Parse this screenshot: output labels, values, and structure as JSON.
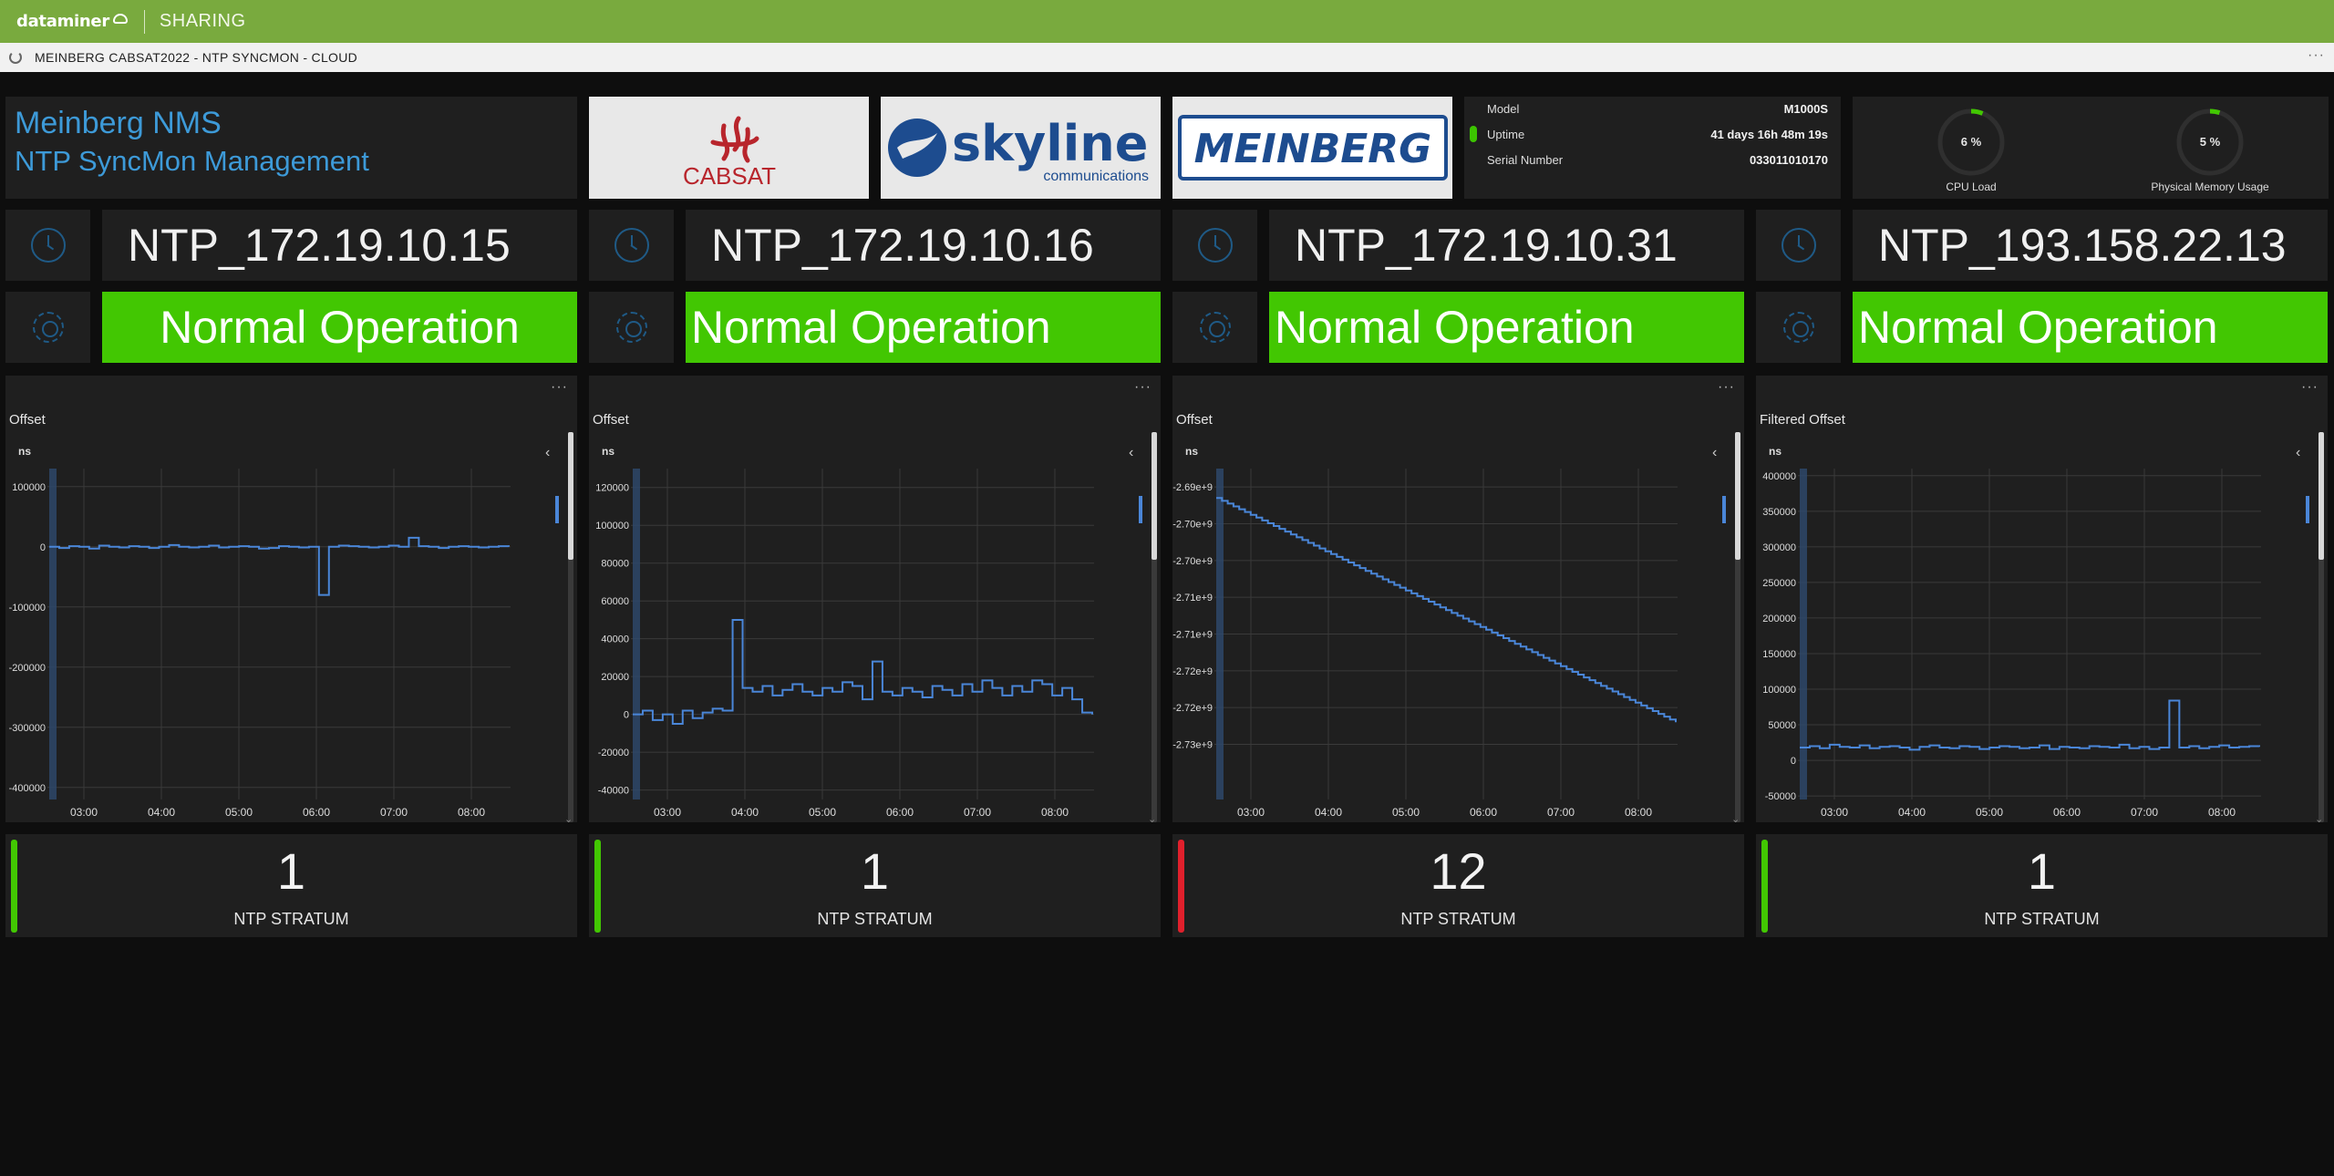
{
  "app": {
    "logo": "dataminer",
    "section": "SHARING"
  },
  "subheader": {
    "title": "MEINBERG CABSAT2022 - NTP SYNCMON - CLOUD",
    "more": "···"
  },
  "brand": {
    "title": "Meinberg NMS",
    "subtitle": "NTP SyncMon Management"
  },
  "logos": {
    "cabsat": "CABSAT",
    "skyline": "skyline",
    "skyline_sub": "communications",
    "meinberg": "MEINBERG"
  },
  "device": {
    "model_label": "Model",
    "model": "M1000S",
    "uptime_label": "Uptime",
    "uptime": "41 days 16h 48m 19s",
    "serial_label": "Serial Number",
    "serial": "033011010170"
  },
  "gauges": [
    {
      "label": "CPU Load",
      "value": "6 %",
      "fraction": 0.06
    },
    {
      "label": "Physical Memory Usage",
      "value": "5 %",
      "fraction": 0.05
    }
  ],
  "colors": {
    "accent": "#3d9ad8",
    "ok": "#42c702",
    "alarm": "#e0202c",
    "series": "#4a86d8",
    "brand_green": "#79aa3e"
  },
  "servers": [
    {
      "name": "NTP_172.19.10.15",
      "status": "Normal Operation",
      "stratum": "1",
      "stratum_label": "NTP STRATUM",
      "stratum_state": "ok"
    },
    {
      "name": "NTP_172.19.10.16",
      "status": "Normal Operation",
      "stratum": "1",
      "stratum_label": "NTP STRATUM",
      "stratum_state": "ok"
    },
    {
      "name": "NTP_172.19.10.31",
      "status": "Normal Operation",
      "stratum": "12",
      "stratum_label": "NTP STRATUM",
      "stratum_state": "alarm"
    },
    {
      "name": "NTP_193.158.22.13",
      "status": "Normal Operation",
      "stratum": "1",
      "stratum_label": "NTP STRATUM",
      "stratum_state": "ok"
    }
  ],
  "chart_data": [
    {
      "type": "line",
      "title": "Offset",
      "ylabel": "ns",
      "x": [
        "03:00",
        "04:00",
        "05:00",
        "06:00",
        "07:00",
        "08:00"
      ],
      "ylim": [
        -420000,
        130000
      ],
      "yticks": [
        "100000",
        "0",
        "-100000",
        "-200000",
        "-300000",
        "-400000"
      ],
      "ytick_values": [
        100000,
        0,
        -100000,
        -200000,
        -300000,
        -400000
      ],
      "series": [
        {
          "values": [
            0,
            -2000,
            1000,
            0,
            -3000,
            2000,
            0,
            -1000,
            1000,
            0,
            -2000,
            0,
            3000,
            0,
            -1000,
            0,
            2000,
            -1000,
            0,
            1000,
            0,
            -3000,
            -2000,
            1000,
            0,
            -1000,
            0,
            -80000,
            0,
            2000,
            1000,
            0,
            -1000,
            0,
            2000,
            0,
            15000,
            1000,
            0,
            -2000,
            0,
            1000,
            0,
            -1000,
            0,
            1000,
            0
          ]
        }
      ]
    },
    {
      "type": "line",
      "title": "Offset",
      "ylabel": "ns",
      "x": [
        "03:00",
        "04:00",
        "05:00",
        "06:00",
        "07:00",
        "08:00"
      ],
      "ylim": [
        -45000,
        130000
      ],
      "yticks": [
        "120000",
        "100000",
        "80000",
        "60000",
        "40000",
        "20000",
        "0",
        "-20000",
        "-40000"
      ],
      "ytick_values": [
        120000,
        100000,
        80000,
        60000,
        40000,
        20000,
        0,
        -20000,
        -40000
      ],
      "series": [
        {
          "values": [
            0,
            2000,
            -3000,
            0,
            -5000,
            2000,
            -2000,
            1000,
            3000,
            2000,
            50000,
            14000,
            12000,
            15000,
            10000,
            13000,
            16000,
            12000,
            10000,
            14000,
            12000,
            17000,
            15000,
            8000,
            28000,
            12000,
            10000,
            14000,
            12000,
            9000,
            15000,
            13000,
            10000,
            16000,
            12000,
            18000,
            14000,
            10000,
            15000,
            12000,
            18000,
            16000,
            10000,
            14000,
            8000,
            1000,
            0
          ]
        }
      ]
    },
    {
      "type": "line",
      "title": "Offset",
      "ylabel": "ns",
      "x": [
        "03:00",
        "04:00",
        "05:00",
        "06:00",
        "07:00",
        "08:00"
      ],
      "ylim": [
        -2732500000.0,
        -2687500000.0
      ],
      "yticks": [
        "-2.69e+9",
        "-2.70e+9",
        "-2.70e+9",
        "-2.71e+9",
        "-2.71e+9",
        "-2.72e+9",
        "-2.72e+9",
        "-2.73e+9"
      ],
      "ytick_values": [
        -2690000000.0,
        -2695000000.0,
        -2700000000.0,
        -2705000000.0,
        -2710000000.0,
        -2715000000.0,
        -2720000000.0,
        -2725000000.0
      ],
      "series": [
        {
          "start": -2691500000.0,
          "end": -2722000000.0
        }
      ]
    },
    {
      "type": "line",
      "title": "Filtered Offset",
      "ylabel": "ns",
      "x": [
        "03:00",
        "04:00",
        "05:00",
        "06:00",
        "07:00",
        "08:00"
      ],
      "ylim": [
        -55000,
        410000
      ],
      "yticks": [
        "400000",
        "350000",
        "300000",
        "250000",
        "200000",
        "150000",
        "100000",
        "50000",
        "0",
        "-50000"
      ],
      "ytick_values": [
        400000,
        350000,
        300000,
        250000,
        200000,
        150000,
        100000,
        50000,
        0,
        -50000
      ],
      "series": [
        {
          "values": [
            18000,
            20000,
            17000,
            22000,
            19000,
            18000,
            21000,
            17000,
            19000,
            20000,
            18000,
            15000,
            19000,
            21000,
            18000,
            17000,
            20000,
            19000,
            16000,
            18000,
            20000,
            19000,
            17000,
            18000,
            21000,
            16000,
            19000,
            18000,
            17000,
            20000,
            19000,
            18000,
            22000,
            17000,
            19000,
            16000,
            18000,
            84000,
            18000,
            20000,
            17000,
            19000,
            21000,
            18000,
            19000,
            20000,
            19000
          ]
        }
      ]
    }
  ]
}
